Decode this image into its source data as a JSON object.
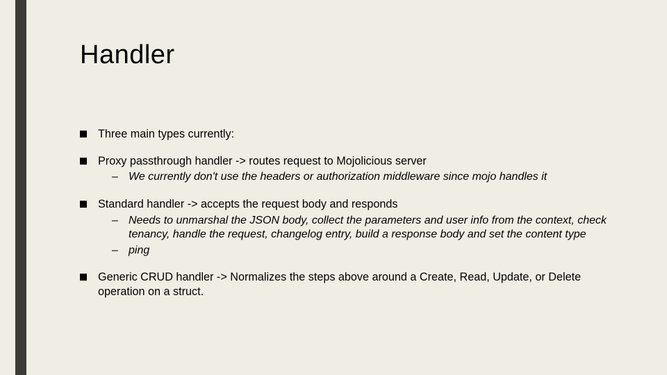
{
  "title": "Handler",
  "b0": "Three main types currently:",
  "b1": "Proxy passthrough handler -> routes request to Mojolicious server",
  "b1s0": "We currently don't use the headers or authorization middleware since mojo handles it",
  "b2": "Standard handler -> accepts the request body and responds",
  "b2s0": "Needs to unmarshal the JSON body, collect the parameters and user info from the context, check tenancy, handle the request, changelog entry, build a response body and set the content type",
  "b2s1": "ping",
  "b3": "Generic CRUD handler -> Normalizes the steps above around a Create, Read, Update, or Delete operation on a struct."
}
